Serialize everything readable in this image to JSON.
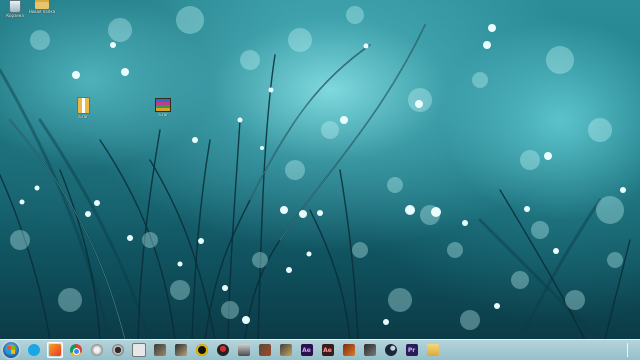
{
  "desktop": {
    "icons": [
      {
        "id": "recycle-bin",
        "label": "Корзина"
      },
      {
        "id": "new-folder",
        "label": "Новая папка"
      },
      {
        "id": "archive-1",
        "label": "a.rar"
      },
      {
        "id": "archive-2",
        "label": "a.rar"
      }
    ]
  },
  "taskbar": {
    "start_label": "Start",
    "items": [
      {
        "name": "skype",
        "active": false
      },
      {
        "name": "windows-media",
        "active": true
      },
      {
        "name": "chrome",
        "active": false
      },
      {
        "name": "app-4",
        "active": false
      },
      {
        "name": "app-5",
        "active": false
      },
      {
        "name": "app-6",
        "active": false
      },
      {
        "name": "game-1",
        "active": false
      },
      {
        "name": "game-2",
        "active": false
      },
      {
        "name": "game-3",
        "active": false
      },
      {
        "name": "game-4",
        "active": false
      },
      {
        "name": "game-5",
        "active": false
      },
      {
        "name": "game-6",
        "active": false
      },
      {
        "name": "game-7",
        "active": false
      },
      {
        "name": "after-effects",
        "active": false
      },
      {
        "name": "adobe-media-encoder",
        "active": false
      },
      {
        "name": "game-8",
        "active": false
      },
      {
        "name": "game-9",
        "active": false
      },
      {
        "name": "steam",
        "active": false
      },
      {
        "name": "premiere",
        "active": false
      },
      {
        "name": "explorer",
        "active": false
      }
    ],
    "labels": {
      "after_effects": "Ae",
      "media_encoder": "Ae",
      "premiere": "Pr"
    }
  },
  "colors": {
    "wallpaper_accent": "#2b8e99",
    "taskbar": "#c8e4ea",
    "ae": "#2b0f4a",
    "pr": "#2a1c56"
  }
}
